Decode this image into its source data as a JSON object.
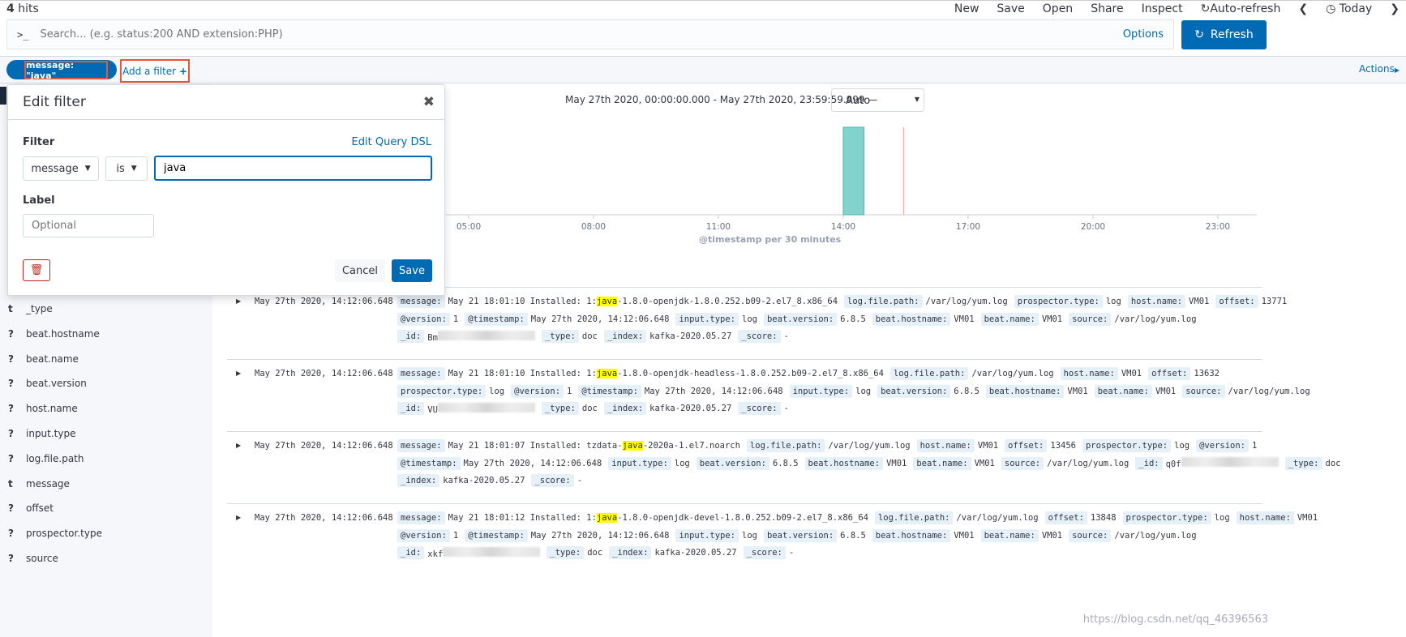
{
  "header": {
    "hits_count": "4",
    "hits_label": " hits",
    "menu": [
      "New",
      "Save",
      "Open",
      "Share",
      "Inspect",
      "Auto-refresh",
      "Today"
    ]
  },
  "search": {
    "prompt": ">_",
    "placeholder": "Search... (e.g. status:200 AND extension:PHP)",
    "options_label": "Options",
    "refresh_label": "Refresh"
  },
  "filters": {
    "pill": "message: \"java\"",
    "add_filter": "Add a filter",
    "actions": "Actions"
  },
  "popover": {
    "title": "Edit filter",
    "filter_label": "Filter",
    "edit_dsl": "Edit Query DSL",
    "field": "message",
    "operator": "is",
    "value": "java",
    "label_label": "Label",
    "label_placeholder": "Optional",
    "cancel": "Cancel",
    "save": "Save"
  },
  "sidebar": {
    "fields": [
      {
        "type": "t",
        "name": "_type"
      },
      {
        "type": "?",
        "name": "beat.hostname"
      },
      {
        "type": "?",
        "name": "beat.name"
      },
      {
        "type": "?",
        "name": "beat.version"
      },
      {
        "type": "?",
        "name": "host.name"
      },
      {
        "type": "?",
        "name": "input.type"
      },
      {
        "type": "?",
        "name": "log.file.path"
      },
      {
        "type": "t",
        "name": "message"
      },
      {
        "type": "?",
        "name": "offset"
      },
      {
        "type": "?",
        "name": "prospector.type"
      },
      {
        "type": "?",
        "name": "source"
      }
    ]
  },
  "histogram": {
    "range": "May 27th 2020, 00:00:00.000 - May 27th 2020, 23:59:59.999 —",
    "interval": "Auto",
    "xlabel": "@timestamp per 30 minutes",
    "ticks": [
      "05:00",
      "08:00",
      "11:00",
      "14:00",
      "17:00",
      "20:00",
      "23:00"
    ],
    "bars": [
      {
        "start": "14:00",
        "end": "14:30",
        "count": 4
      }
    ],
    "now_marker": "15:27",
    "bar_color": "#81d3cc",
    "marker_color": "#f0a0a0"
  },
  "documents": [
    {
      "timestamp": "May 27th 2020, 14:12:06.648",
      "lines": [
        [
          [
            "message:",
            "May 21 18:01:10 Installed: 1:",
            "java",
            "-1.8.0-openjdk-1.8.0.252.b09-2.el7_8.x86_64"
          ],
          [
            "log.file.path:",
            "/var/log/yum.log"
          ],
          [
            "prospector.type:",
            "log"
          ],
          [
            "host.name:",
            "VM01"
          ],
          [
            "offset:",
            "13771"
          ]
        ],
        [
          [
            "@version:",
            "1"
          ],
          [
            "@timestamp:",
            "May 27th 2020, 14:12:06.648"
          ],
          [
            "input.type:",
            "log"
          ],
          [
            "beat.version:",
            "6.8.5"
          ],
          [
            "beat.hostname:",
            "VM01"
          ],
          [
            "beat.name:",
            "VM01"
          ],
          [
            "source:",
            "/var/log/yum.log"
          ]
        ],
        [
          [
            "_id:",
            "Bm",
            "",
            "",
            " blur"
          ],
          [
            "_type:",
            "doc"
          ],
          [
            "_index:",
            "kafka-2020.05.27"
          ],
          [
            "_score:",
            "-"
          ]
        ]
      ]
    },
    {
      "timestamp": "May 27th 2020, 14:12:06.648",
      "lines": [
        [
          [
            "message:",
            "May 21 18:01:10 Installed: 1:",
            "java",
            "-1.8.0-openjdk-headless-1.8.0.252.b09-2.el7_8.x86_64"
          ],
          [
            "log.file.path:",
            "/var/log/yum.log"
          ],
          [
            "host.name:",
            "VM01"
          ],
          [
            "offset:",
            "13632"
          ]
        ],
        [
          [
            "prospector.type:",
            "log"
          ],
          [
            "@version:",
            "1"
          ],
          [
            "@timestamp:",
            "May 27th 2020, 14:12:06.648"
          ],
          [
            "input.type:",
            "log"
          ],
          [
            "beat.version:",
            "6.8.5"
          ],
          [
            "beat.hostname:",
            "VM01"
          ],
          [
            "beat.name:",
            "VM01"
          ],
          [
            "source:",
            "/var/log/yum.log"
          ]
        ],
        [
          [
            "_id:",
            "VU",
            "",
            "",
            " blur"
          ],
          [
            "_type:",
            "doc"
          ],
          [
            "_index:",
            "kafka-2020.05.27"
          ],
          [
            "_score:",
            "-"
          ]
        ]
      ]
    },
    {
      "timestamp": "May 27th 2020, 14:12:06.648",
      "lines": [
        [
          [
            "message:",
            "May 21 18:01:07 Installed: tzdata-",
            "java",
            "-2020a-1.el7.noarch"
          ],
          [
            "log.file.path:",
            "/var/log/yum.log"
          ],
          [
            "host.name:",
            "VM01"
          ],
          [
            "offset:",
            "13456"
          ],
          [
            "prospector.type:",
            "log"
          ],
          [
            "@version:",
            "1"
          ]
        ],
        [
          [
            "@timestamp:",
            "May 27th 2020, 14:12:06.648"
          ],
          [
            "input.type:",
            "log"
          ],
          [
            "beat.version:",
            "6.8.5"
          ],
          [
            "beat.hostname:",
            "VM01"
          ],
          [
            "beat.name:",
            "VM01"
          ],
          [
            "source:",
            "/var/log/yum.log"
          ],
          [
            "_id:",
            "q0f",
            "",
            "",
            " blur"
          ],
          [
            "_type:",
            "doc"
          ]
        ],
        [
          [
            "_index:",
            "kafka-2020.05.27"
          ],
          [
            "_score:",
            "-"
          ]
        ]
      ]
    },
    {
      "timestamp": "May 27th 2020, 14:12:06.648",
      "lines": [
        [
          [
            "message:",
            "May 21 18:01:12 Installed: 1:",
            "java",
            "-1.8.0-openjdk-devel-1.8.0.252.b09-2.el7_8.x86_64"
          ],
          [
            "log.file.path:",
            "/var/log/yum.log"
          ],
          [
            "offset:",
            "13848"
          ],
          [
            "prospector.type:",
            "log"
          ],
          [
            "host.name:",
            "VM01"
          ]
        ],
        [
          [
            "@version:",
            "1"
          ],
          [
            "@timestamp:",
            "May 27th 2020, 14:12:06.648"
          ],
          [
            "input.type:",
            "log"
          ],
          [
            "beat.version:",
            "6.8.5"
          ],
          [
            "beat.hostname:",
            "VM01"
          ],
          [
            "beat.name:",
            "VM01"
          ],
          [
            "source:",
            "/var/log/yum.log"
          ]
        ],
        [
          [
            "_id:",
            "xkf",
            "",
            "",
            " blur"
          ],
          [
            "_type:",
            "doc"
          ],
          [
            "_index:",
            "kafka-2020.05.27"
          ],
          [
            "_score:",
            "-"
          ]
        ]
      ]
    }
  ],
  "watermark": "https://blog.csdn.net/qq_46396563"
}
